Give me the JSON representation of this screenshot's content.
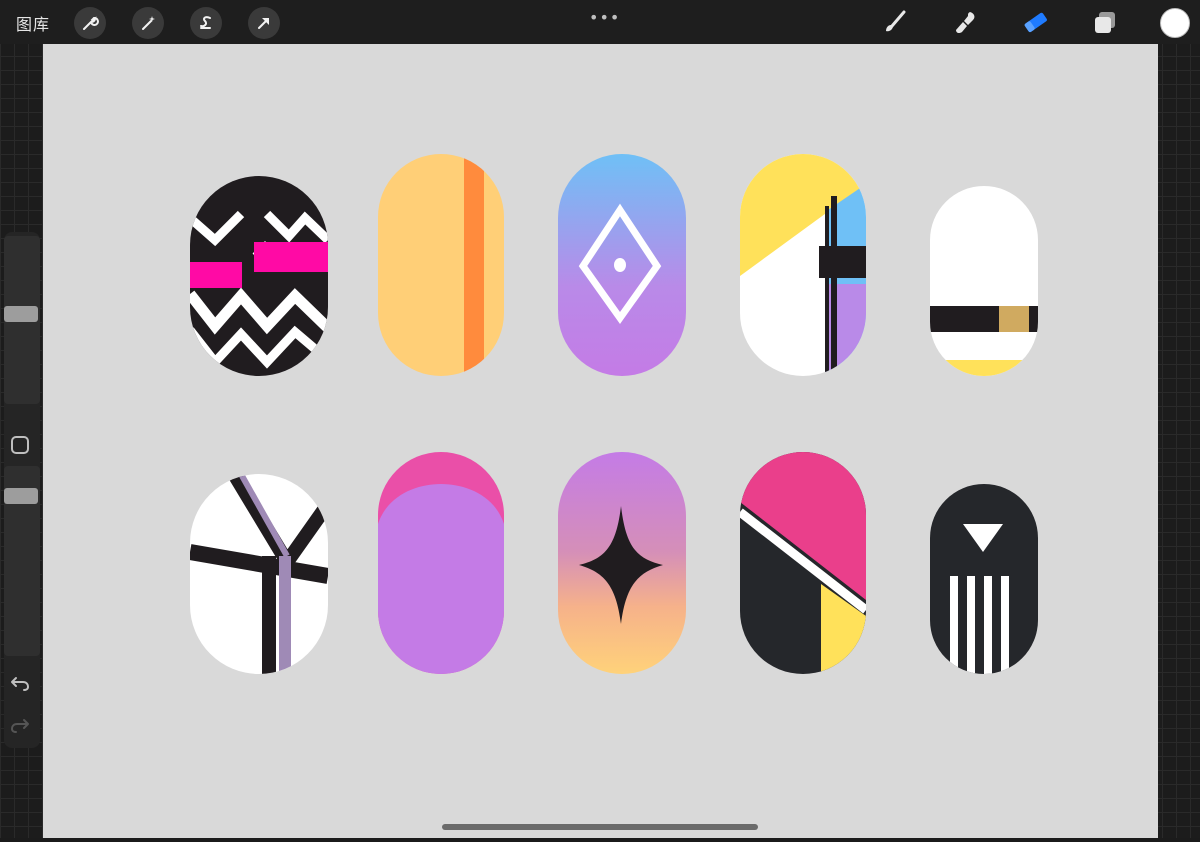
{
  "app": {
    "gallery_label": "图库",
    "more_dots": "•••",
    "current_color": "#ffffff",
    "active_tool": "eraser"
  },
  "toolbar_left": [
    {
      "name": "wrench-icon",
      "label": "actions"
    },
    {
      "name": "magic-wand-icon",
      "label": "adjustments"
    },
    {
      "name": "selection-icon",
      "label": "selection"
    },
    {
      "name": "transform-arrow-icon",
      "label": "transform"
    }
  ],
  "toolbar_right": [
    {
      "name": "brush-icon"
    },
    {
      "name": "smudge-icon"
    },
    {
      "name": "eraser-icon",
      "active": true,
      "color": "#1f7bff"
    },
    {
      "name": "layers-icon"
    }
  ],
  "sidebar": {
    "brush_size_level": 0.46,
    "opacity_level": 0.95
  },
  "colors": {
    "black": "#201c1f",
    "pink": "#ff0aa5",
    "yellow_orange": "#ffcf77",
    "orange": "#ff8b3d",
    "blue": "#6fc0f6",
    "purple": "#c47be6",
    "yellow": "#ffe15a",
    "tan": "#d0aa60",
    "magenta": "#ea3f8b",
    "grey_violet": "#9f8ab6",
    "canvas": "#d9d9d9"
  },
  "nail_designs": [
    "chevron-black-pink",
    "peach-orange-stripe",
    "blue-purple-diamond",
    "yellow-blue-block",
    "white-black-band",
    "white-y-lines",
    "purple-pink-tip",
    "gradient-star",
    "pink-black-yellow-diagonal",
    "black-triangle-stripes"
  ]
}
